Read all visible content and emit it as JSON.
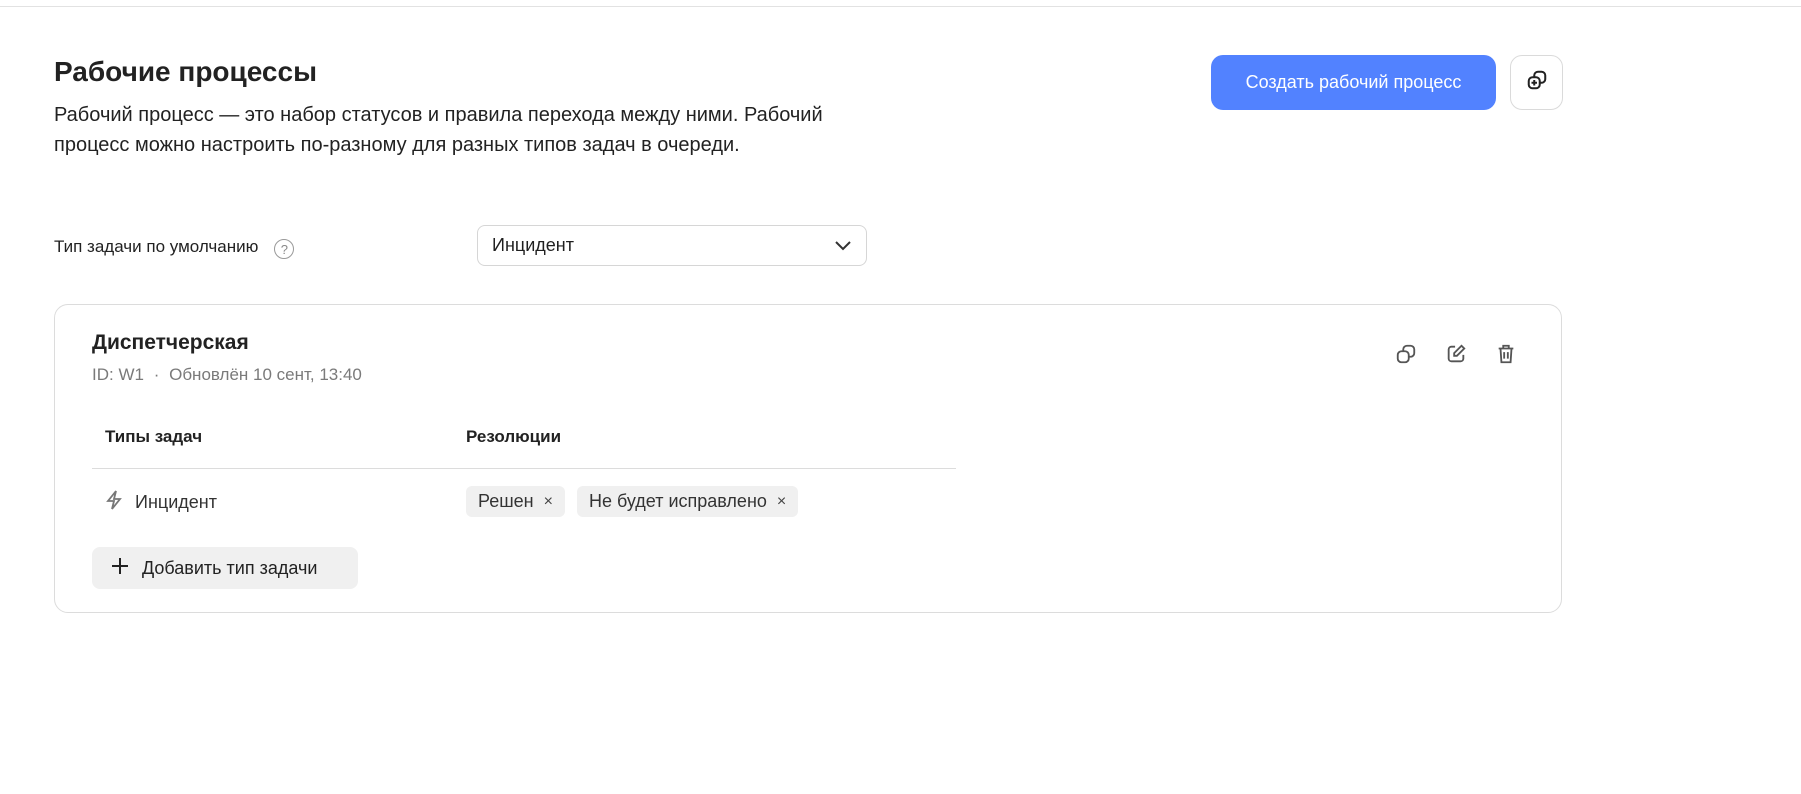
{
  "header": {
    "title": "Рабочие процессы",
    "description": "Рабочий процесс — это набор статусов и правила перехода между ними. Рабочий процесс можно настроить по-разному для разных типов задач в очереди.",
    "create_button": "Создать рабочий процесс",
    "copy_button_icon": "copy-plus-icon"
  },
  "default_type": {
    "label": "Тип задачи по умолчанию",
    "help": "?",
    "value": "Инцидент"
  },
  "workflow": {
    "name": "Диспетчерская",
    "id": "ID: W1",
    "separator": "·",
    "updated": "Обновлён 10 сент, 13:40",
    "col_types": "Типы задач",
    "col_resolutions": "Резолюции",
    "rows": [
      {
        "type": "Инцидент",
        "resolutions": [
          "Решен",
          "Не будет исправлено"
        ]
      }
    ],
    "add_type": "Добавить тип задачи",
    "remove_symbol": "×"
  },
  "colors": {
    "accent": "#5282ff"
  }
}
